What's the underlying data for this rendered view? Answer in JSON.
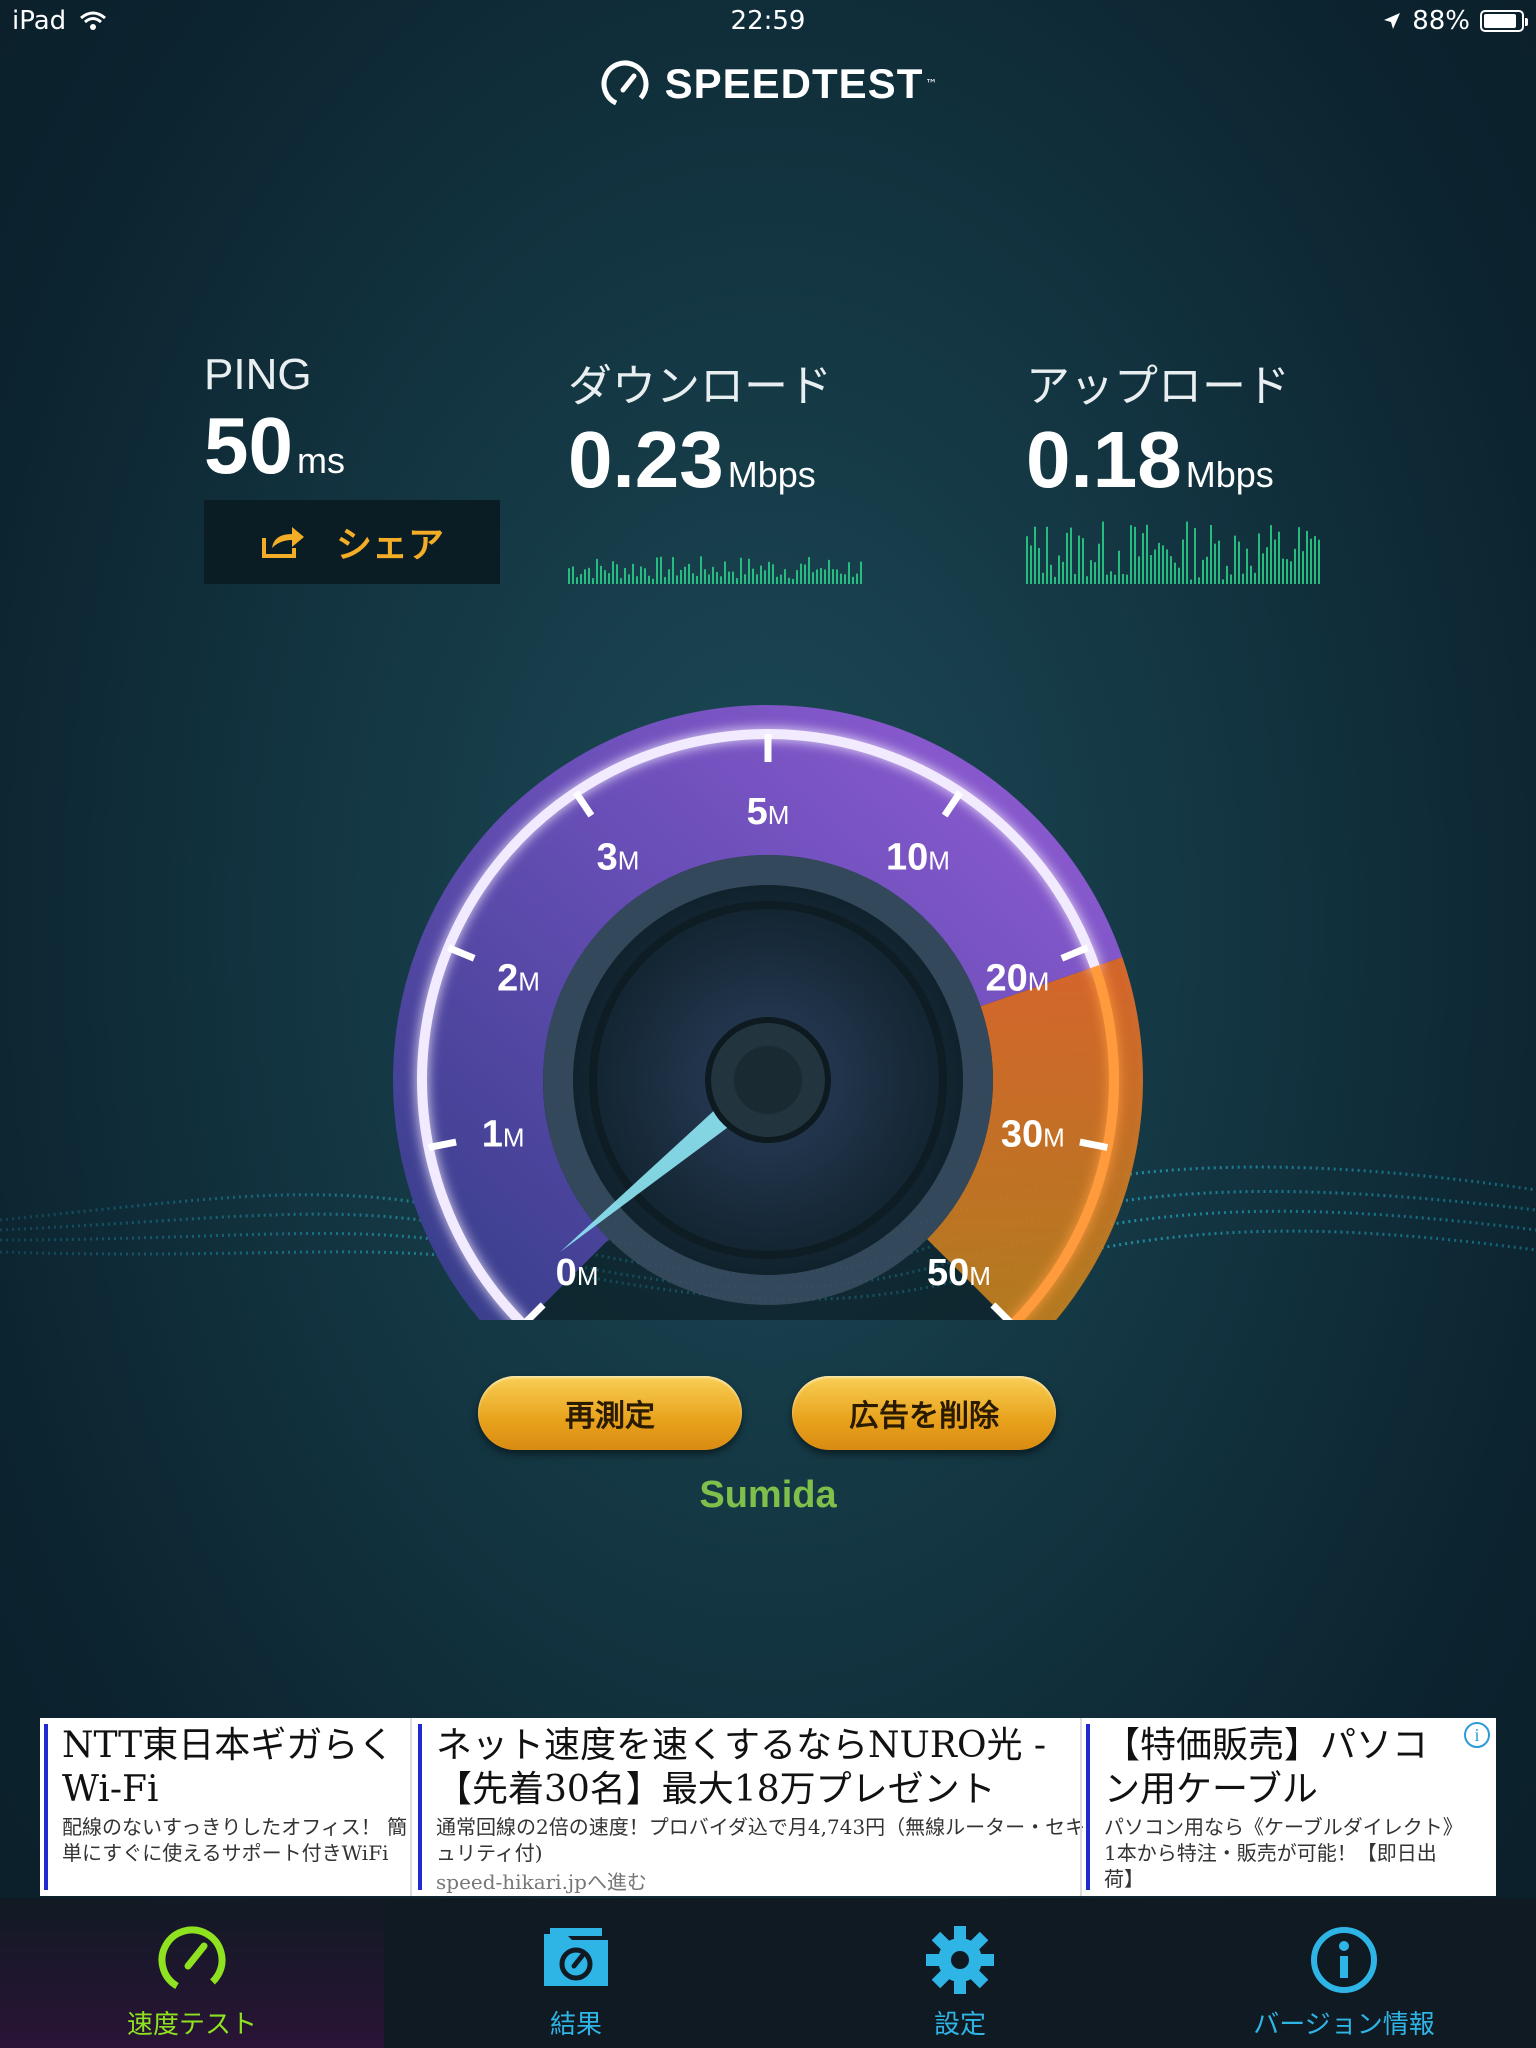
{
  "status_bar": {
    "device": "iPad",
    "time": "22:59",
    "battery": "88%",
    "battery_level": 0.88
  },
  "header": {
    "title": "SPEEDTEST",
    "tm": "™"
  },
  "stats": {
    "ping": {
      "label": "PING",
      "value": "50",
      "unit": "ms"
    },
    "download": {
      "label": "ダウンロード",
      "value": "0.23",
      "unit": "Mbps"
    },
    "upload": {
      "label": "アップロード",
      "value": "0.18",
      "unit": "Mbps"
    }
  },
  "share": {
    "label": "シェア"
  },
  "gauge": {
    "ticks": [
      {
        "num": "0",
        "unit": "M"
      },
      {
        "num": "1",
        "unit": "M"
      },
      {
        "num": "2",
        "unit": "M"
      },
      {
        "num": "3",
        "unit": "M"
      },
      {
        "num": "5",
        "unit": "M"
      },
      {
        "num": "10",
        "unit": "M"
      },
      {
        "num": "20",
        "unit": "M"
      },
      {
        "num": "30",
        "unit": "M"
      },
      {
        "num": "50",
        "unit": "M"
      }
    ],
    "needle_fraction": 0.02
  },
  "actions": {
    "retest": "再測定",
    "remove_ads": "広告を削除"
  },
  "server": {
    "name": "Sumida"
  },
  "ads": [
    {
      "headline": "NTT東日本ギガらくWi-Fi",
      "desc": "配線のないすっきりしたオフィス！ 簡単にすぐに使えるサポート付きWiFi",
      "url": ""
    },
    {
      "headline": "ネット速度を速くするならNURO光 - 【先着30名】最大18万プレゼント",
      "desc": "通常回線の2倍の速度！プロバイダ込で月4,743円（無線ルーター・セキュリティ付)",
      "url": "speed-hikari.jpへ進む"
    },
    {
      "headline": "【特価販売】パソコン用ケーブル",
      "desc": "パソコン用なら《ケーブルダイレクト》1本から特注・販売が可能！【即日出荷】",
      "url": ""
    }
  ],
  "tabs": [
    {
      "label": "速度テスト",
      "icon": "speedometer-icon",
      "active": true
    },
    {
      "label": "結果",
      "icon": "results-folder-icon",
      "active": false
    },
    {
      "label": "設定",
      "icon": "gear-icon",
      "active": false
    },
    {
      "label": "バージョン情報",
      "icon": "info-icon",
      "active": false
    }
  ],
  "colors": {
    "accent_gold": "#f3ad27",
    "active_tab_green": "#8ee21f",
    "tab_blue": "#2fb4e6",
    "server_green": "#7ec04a"
  }
}
